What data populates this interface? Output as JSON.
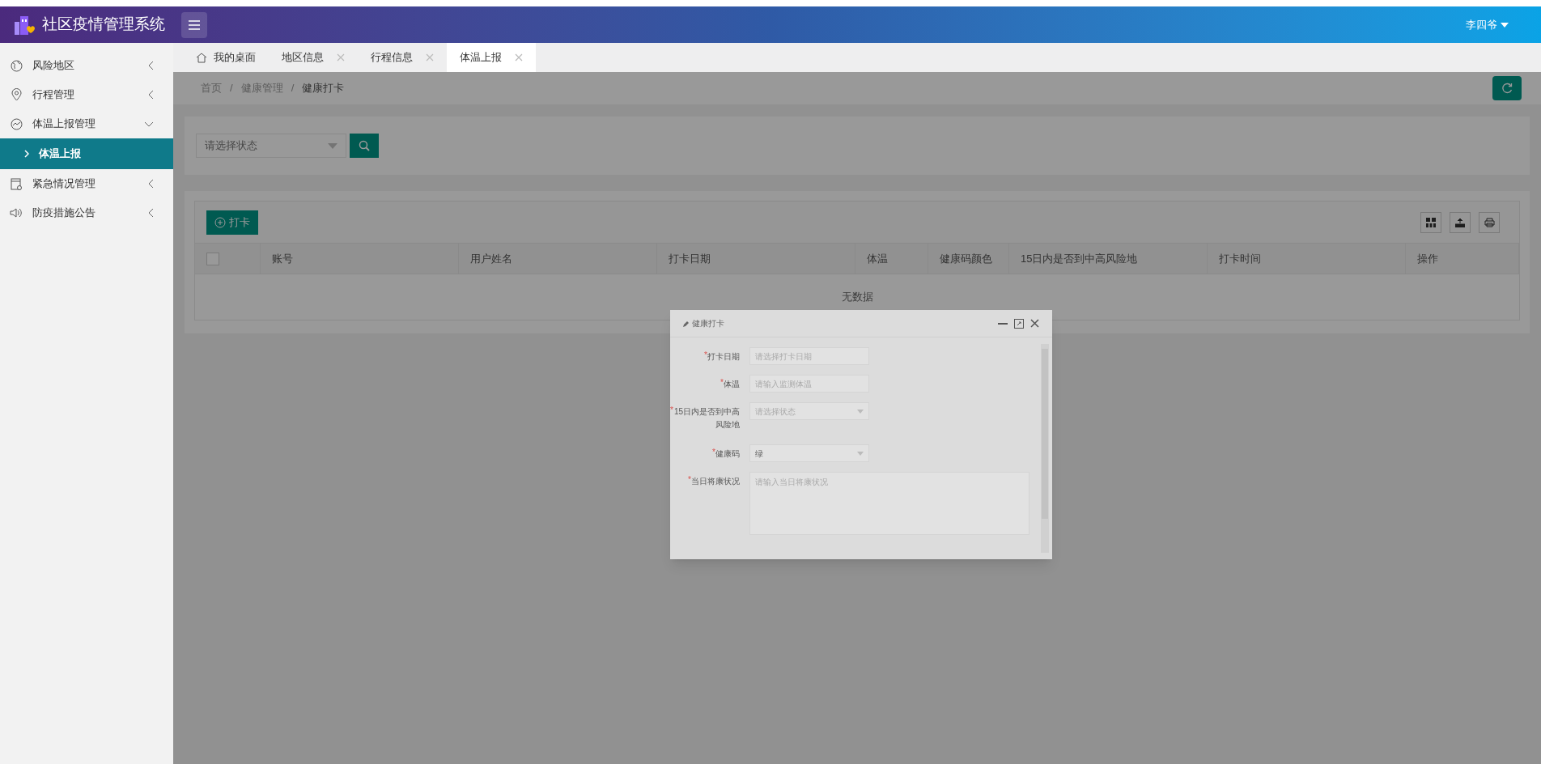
{
  "header": {
    "title": "社区疫情管理系统",
    "user": "李四爷"
  },
  "sidebar": {
    "items": [
      {
        "label": "风险地区",
        "expanded": false,
        "selected": false
      },
      {
        "label": "行程管理",
        "expanded": false,
        "selected": false
      },
      {
        "label": "体温上报管理",
        "expanded": true,
        "selected": false,
        "children": [
          {
            "label": "体温上报",
            "selected": true
          }
        ]
      },
      {
        "label": "紧急情况管理",
        "expanded": false,
        "selected": false
      },
      {
        "label": "防疫措施公告",
        "expanded": false,
        "selected": false
      }
    ]
  },
  "tabs": [
    {
      "label": "我的桌面",
      "kind": "home",
      "selected": false
    },
    {
      "label": "地区信息",
      "kind": "closable",
      "selected": false
    },
    {
      "label": "行程信息",
      "kind": "closable",
      "selected": false
    },
    {
      "label": "体温上报",
      "kind": "closable",
      "selected": true
    }
  ],
  "breadcrumb": {
    "items": [
      "首页",
      "健康管理",
      "健康打卡"
    ],
    "separators": [
      "/",
      "/"
    ]
  },
  "filter": {
    "placeholder": "请选择状态"
  },
  "toolbar": {
    "add_button": "打卡"
  },
  "table": {
    "select_all": {
      "checked": false
    },
    "columns": [
      "账号",
      "用户姓名",
      "打卡日期",
      "体温",
      "健康码颜色",
      "15日内是否到中高风险地",
      "打卡时间",
      "操作"
    ],
    "empty_text": "无数据"
  },
  "dialog": {
    "title": "健康打卡",
    "fields": [
      {
        "kind": "input",
        "label": "打卡日期",
        "required": true,
        "required_mark": "*",
        "placeholder": "请选择打卡日期"
      },
      {
        "kind": "input",
        "label": "体温",
        "required": true,
        "required_mark": "*",
        "placeholder": "请输入监测体温"
      },
      {
        "kind": "select",
        "label": "15日内是否到中高风险地",
        "required": true,
        "required_mark": "*",
        "placeholder": "请选择状态"
      },
      {
        "kind": "select",
        "label": "健康码",
        "required": true,
        "required_mark": "*",
        "value": "绿"
      },
      {
        "kind": "textarea",
        "label": "当日将康状况",
        "required": true,
        "required_mark": "*",
        "placeholder": "请输入当日将康状况"
      }
    ]
  }
}
